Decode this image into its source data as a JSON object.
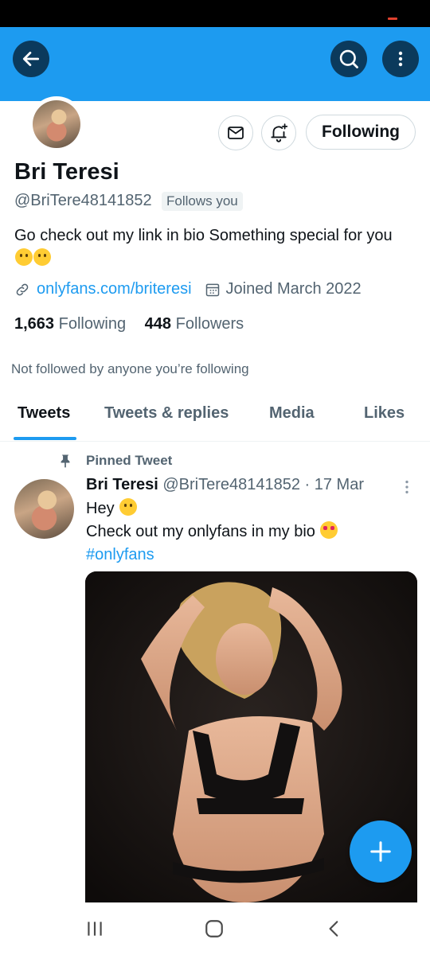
{
  "colors": {
    "accent": "#1d9bf0",
    "text": "#0f1419",
    "muted": "#536471",
    "header_btn": "#0b3a5c"
  },
  "header": {
    "back_icon": "arrow-left-icon",
    "search_icon": "search-icon",
    "more_icon": "more-vertical-icon"
  },
  "profile": {
    "display_name": "Bri Teresi",
    "handle": "@BriTere48141852",
    "follows_you": "Follows you",
    "bio": "Go check out my link in bio  Something special for you",
    "link": "onlyfans.com/briteresi",
    "joined": "Joined March 2022",
    "following_count": "1,663",
    "following_label": "Following",
    "followers_count": "448",
    "followers_label": "Followers",
    "not_followed": "Not followed by anyone you’re following",
    "following_button": "Following"
  },
  "tabs": [
    {
      "label": "Tweets"
    },
    {
      "label": "Tweets & replies"
    },
    {
      "label": "Media"
    },
    {
      "label": "Likes"
    }
  ],
  "tweet": {
    "pinned_label": "Pinned Tweet",
    "author": "Bri Teresi",
    "handle_date": "@BriTere48141852 · 17 Mar",
    "line1": "Hey",
    "line2": "Check out my onlyfans in my bio",
    "hashtag": "#onlyfans"
  },
  "fab_icon": "plus-icon",
  "navbar": {
    "recents_icon": "recents-icon",
    "home_icon": "home-icon",
    "back_icon": "back-chevron-icon"
  }
}
